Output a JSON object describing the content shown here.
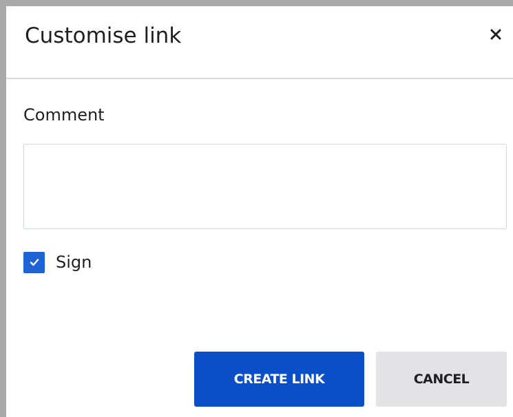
{
  "dialog": {
    "title": "Customise link",
    "close_icon": "close-icon",
    "comment": {
      "label": "Comment",
      "value": "",
      "placeholder": ""
    },
    "sign": {
      "label": "Sign",
      "checked": true
    },
    "buttons": {
      "create_label": "CREATE LINK",
      "cancel_label": "CANCEL"
    }
  },
  "colors": {
    "primary": "#0a4fc8",
    "checkbox": "#1e63d6",
    "secondary_button": "#e3e3e5",
    "backdrop": "#a9a9a9"
  }
}
